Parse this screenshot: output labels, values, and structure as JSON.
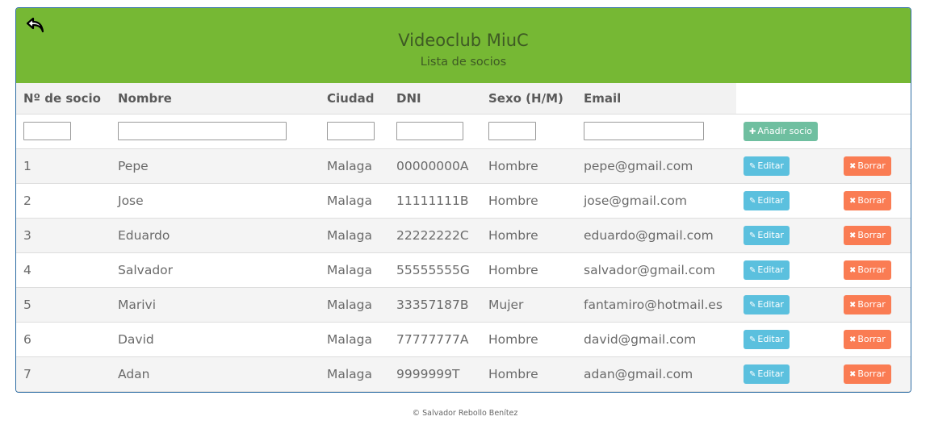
{
  "header": {
    "title": "Videoclub MiuC",
    "subtitle": "Lista de socios",
    "back_icon": "back-arrow-icon",
    "color": "#76b834"
  },
  "table": {
    "columns": [
      "Nº de socio",
      "Nombre",
      "Ciudad",
      "DNI",
      "Sexo (H/M)",
      "Email"
    ],
    "add_button_label": "Añadir socio",
    "edit_label": "Editar",
    "delete_label": "Borrar",
    "rows": [
      {
        "id": "1",
        "nombre": "Pepe",
        "ciudad": "Malaga",
        "dni": "00000000A",
        "sexo": "Hombre",
        "email": "pepe@gmail.com"
      },
      {
        "id": "2",
        "nombre": "Jose",
        "ciudad": "Malaga",
        "dni": "11111111B",
        "sexo": "Hombre",
        "email": "jose@gmail.com"
      },
      {
        "id": "3",
        "nombre": "Eduardo",
        "ciudad": "Malaga",
        "dni": "22222222C",
        "sexo": "Hombre",
        "email": "eduardo@gmail.com"
      },
      {
        "id": "4",
        "nombre": "Salvador",
        "ciudad": "Malaga",
        "dni": "55555555G",
        "sexo": "Hombre",
        "email": "salvador@gmail.com"
      },
      {
        "id": "5",
        "nombre": "Marivi",
        "ciudad": "Malaga",
        "dni": "33357187B",
        "sexo": "Mujer",
        "email": "fantamiro@hotmail.es"
      },
      {
        "id": "6",
        "nombre": "David",
        "ciudad": "Malaga",
        "dni": "77777777A",
        "sexo": "Hombre",
        "email": "david@gmail.com"
      },
      {
        "id": "7",
        "nombre": "Adan",
        "ciudad": "Malaga",
        "dni": "9999999T",
        "sexo": "Hombre",
        "email": "adan@gmail.com"
      }
    ]
  },
  "colors": {
    "add": "#6fbfa0",
    "edit": "#5bc0de",
    "delete": "#fa7c53",
    "border": "#2e6da4"
  },
  "footer": {
    "text": "© Salvador Rebollo Benítez"
  }
}
